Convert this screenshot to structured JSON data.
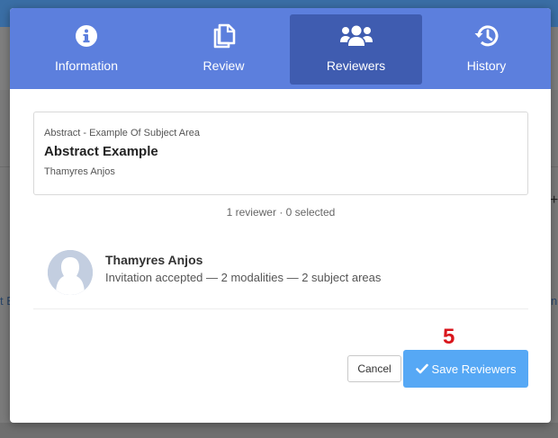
{
  "tabs": [
    {
      "label": "Information",
      "icon": "info-circle-icon",
      "active": false
    },
    {
      "label": "Review",
      "icon": "copy-icon",
      "active": false
    },
    {
      "label": "Reviewers",
      "icon": "users-icon",
      "active": true
    },
    {
      "label": "History",
      "icon": "history-icon",
      "active": false
    }
  ],
  "abstract": {
    "subject_area": "Abstract - Example Of Subject Area",
    "title": "Abstract Example",
    "author": "Thamyres Anjos"
  },
  "reviewer_count": "1 reviewer · 0 selected",
  "reviewers": [
    {
      "name": "Thamyres Anjos",
      "info": "Invitation accepted — 2 modalities — 2 subject areas"
    }
  ],
  "step_number": "5",
  "actions": {
    "cancel_label": "Cancel",
    "save_label": "Save Reviewers"
  },
  "colors": {
    "tab_bar": "#5c7fdd",
    "tab_active": "#3f5cb0",
    "save_button": "#56a8f5",
    "step_marker": "#d9161c"
  }
}
